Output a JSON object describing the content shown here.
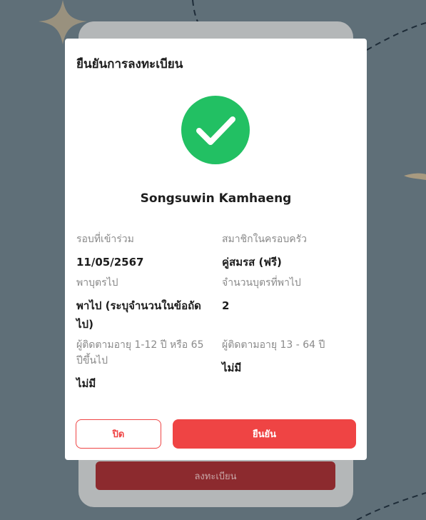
{
  "background": {
    "register_button_label": "ลงทะเบียน"
  },
  "modal": {
    "title": "ยืนยันการลงทะเบียน",
    "success_icon": "check-circle-icon",
    "user_name": "Songsuwin Kamhaeng",
    "fields": [
      {
        "label": "รอบที่เข้าร่วม",
        "value": "11/05/2567"
      },
      {
        "label": "สมาชิกในครอบครัว",
        "value": "คู่สมรส (ฟรี)"
      },
      {
        "label": "พาบุตรไป",
        "value": "พาไป (ระบุจำนวนในข้อถัดไป)"
      },
      {
        "label": "จำนวนบุตรที่พาไป",
        "value": "2"
      },
      {
        "label": "ผู้ติดตามอายุ 1-12 ปี หรือ 65 ปีขึ้นไป",
        "value": "ไม่มี"
      },
      {
        "label": "ผู้ติดตามอายุ 13 - 64 ปี",
        "value": "ไม่มี"
      }
    ],
    "close_label": "ปิด",
    "confirm_label": "ยืนยัน"
  },
  "colors": {
    "accent": "#ef4444",
    "success": "#22c063",
    "overlay": "#5f6f78"
  }
}
